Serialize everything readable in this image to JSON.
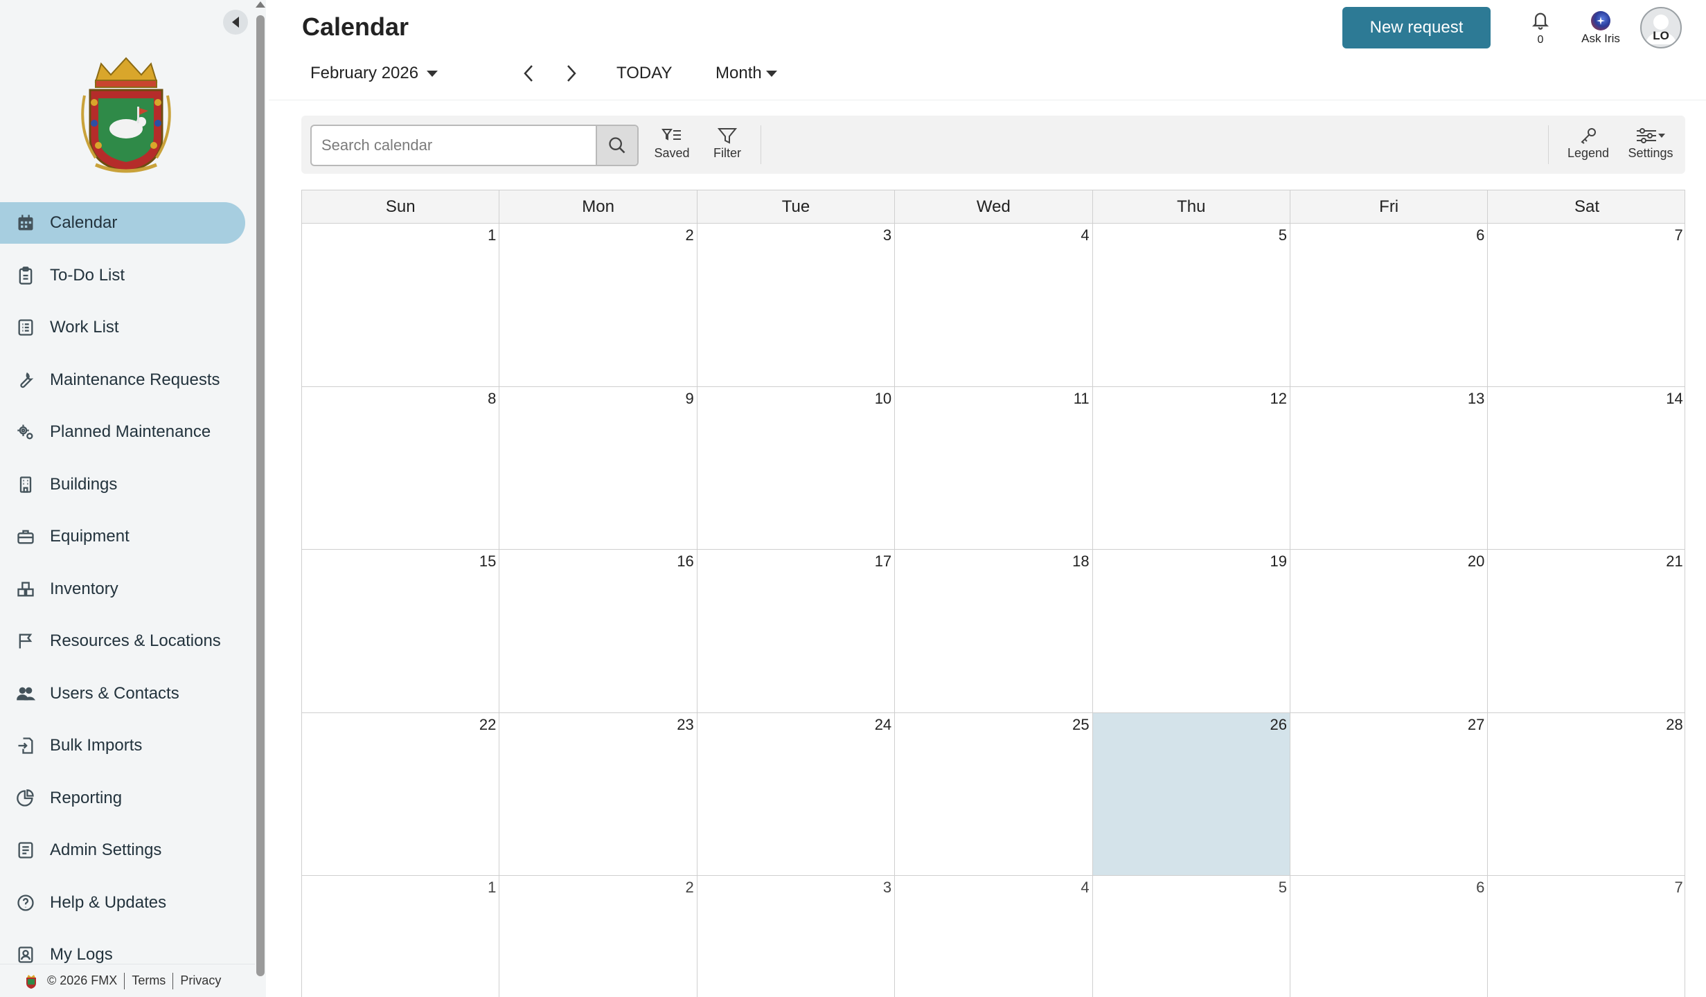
{
  "sidebar": {
    "nav_items": [
      {
        "label": "Calendar",
        "icon": "calendar-icon",
        "active": true
      },
      {
        "label": "To-Do List",
        "icon": "clipboard-icon",
        "active": false
      },
      {
        "label": "Work List",
        "icon": "list-icon",
        "active": false
      },
      {
        "label": "Maintenance Requests",
        "icon": "wrench-icon",
        "active": false
      },
      {
        "label": "Planned Maintenance",
        "icon": "gears-icon",
        "active": false
      },
      {
        "label": "Buildings",
        "icon": "building-icon",
        "active": false
      },
      {
        "label": "Equipment",
        "icon": "toolbox-icon",
        "active": false
      },
      {
        "label": "Inventory",
        "icon": "boxes-icon",
        "active": false
      },
      {
        "label": "Resources & Locations",
        "icon": "flag-icon",
        "active": false
      },
      {
        "label": "Users & Contacts",
        "icon": "users-icon",
        "active": false
      },
      {
        "label": "Bulk Imports",
        "icon": "import-icon",
        "active": false
      },
      {
        "label": "Reporting",
        "icon": "pie-chart-icon",
        "active": false
      },
      {
        "label": "Admin Settings",
        "icon": "admin-icon",
        "active": false
      },
      {
        "label": "Help & Updates",
        "icon": "help-icon",
        "active": false
      },
      {
        "label": "My Logs",
        "icon": "person-log-icon",
        "active": false
      }
    ],
    "footer": {
      "copyright": "© 2026 FMX",
      "terms": "Terms",
      "privacy": "Privacy"
    }
  },
  "header": {
    "title": "Calendar",
    "new_request_label": "New request",
    "notification_count": "0",
    "ask_iris_label": "Ask Iris",
    "avatar_initials": "LO"
  },
  "nav_bar": {
    "month_label": "February 2026",
    "today_label": "TODAY",
    "view_label": "Month"
  },
  "toolbar": {
    "search_placeholder": "Search calendar",
    "saved_label": "Saved",
    "filter_label": "Filter",
    "legend_label": "Legend",
    "settings_label": "Settings"
  },
  "calendar": {
    "weekdays": [
      "Sun",
      "Mon",
      "Tue",
      "Wed",
      "Thu",
      "Fri",
      "Sat"
    ],
    "weeks": [
      [
        {
          "d": "1"
        },
        {
          "d": "2"
        },
        {
          "d": "3"
        },
        {
          "d": "4"
        },
        {
          "d": "5"
        },
        {
          "d": "6"
        },
        {
          "d": "7"
        }
      ],
      [
        {
          "d": "8"
        },
        {
          "d": "9"
        },
        {
          "d": "10"
        },
        {
          "d": "11"
        },
        {
          "d": "12"
        },
        {
          "d": "13"
        },
        {
          "d": "14"
        }
      ],
      [
        {
          "d": "15"
        },
        {
          "d": "16"
        },
        {
          "d": "17"
        },
        {
          "d": "18"
        },
        {
          "d": "19"
        },
        {
          "d": "20"
        },
        {
          "d": "21"
        }
      ],
      [
        {
          "d": "22"
        },
        {
          "d": "23"
        },
        {
          "d": "24"
        },
        {
          "d": "25"
        },
        {
          "d": "26",
          "today": true
        },
        {
          "d": "27"
        },
        {
          "d": "28"
        }
      ],
      [
        {
          "d": "1",
          "other": true
        },
        {
          "d": "2",
          "other": true
        },
        {
          "d": "3",
          "other": true
        },
        {
          "d": "4",
          "other": true
        },
        {
          "d": "5",
          "other": true
        },
        {
          "d": "6",
          "other": true
        },
        {
          "d": "7",
          "other": true
        }
      ]
    ]
  },
  "colors": {
    "accent": "#2d7a95",
    "active_nav": "#a7cee0",
    "today_cell": "#d4e3ea"
  }
}
